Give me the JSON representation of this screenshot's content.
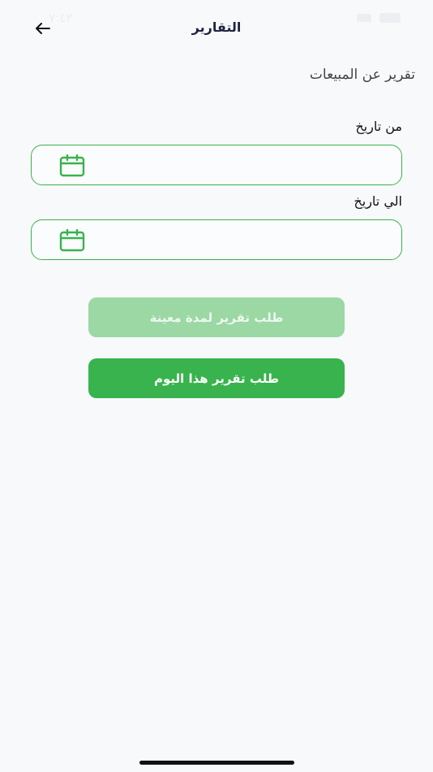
{
  "status_bar": {
    "time": "٧:٤٢"
  },
  "header": {
    "title": "التقارير",
    "back_icon": "arrow-left-icon"
  },
  "section": {
    "title": "تقرير عن المبيعات"
  },
  "form": {
    "from_label": "من تاريخ",
    "from_value": "",
    "to_label": "الي تاريخ",
    "to_value": "",
    "calendar_icon": "calendar-icon"
  },
  "buttons": {
    "period_report": "طلب تقرير لمدة معينة",
    "today_report": "طلب تقرير هذا اليوم"
  },
  "colors": {
    "accent": "#38b34d",
    "accent_disabled": "#9bd8a4",
    "title": "#1f2340"
  }
}
